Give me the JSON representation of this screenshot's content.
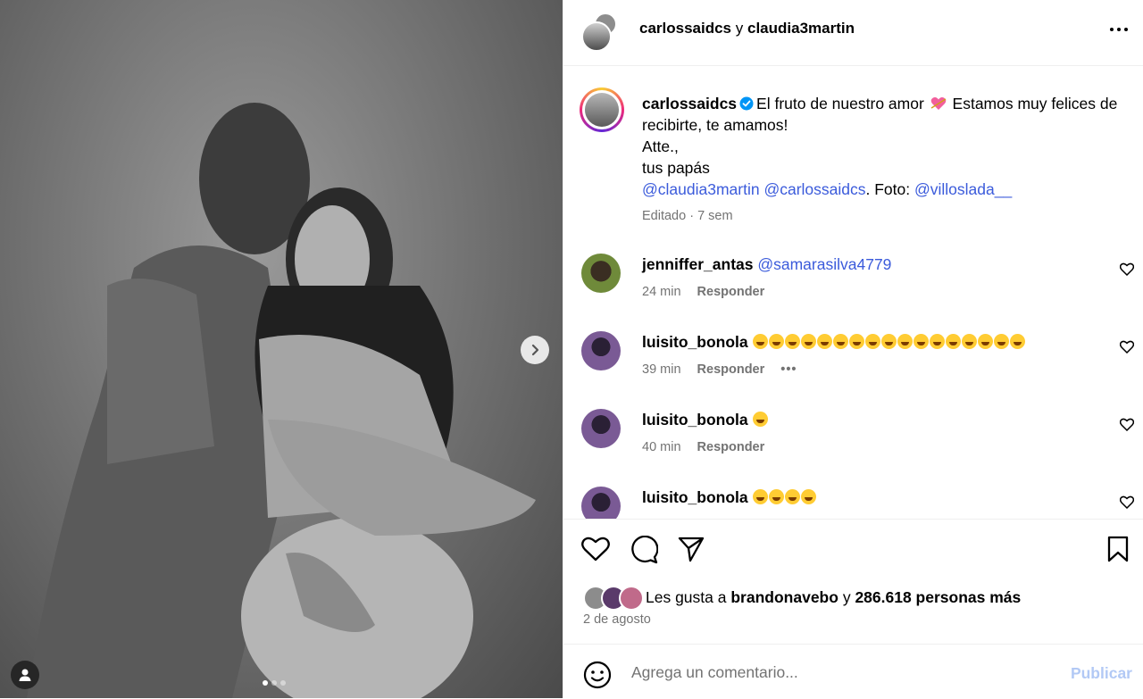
{
  "header": {
    "user1": "carlossaidcs",
    "joiner": "y",
    "user2": "claudia3martin"
  },
  "caption": {
    "username": "carlossaidcs",
    "text1": "El fruto de nuestro amor",
    "text2": "Estamos muy felices de recibirte, te amamos!",
    "line2": "Atte.,",
    "line3": "tus papás",
    "mention1": "@claudia3martin",
    "mention2": "@carlossaidcs",
    "foto_label": ". Foto:",
    "mention3": "@villoslada__",
    "edited": "Editado",
    "sep": "·",
    "time": "7 sem"
  },
  "comments": [
    {
      "username": "jenniffer_antas",
      "mention": "@samarasilva4779",
      "time": "24 min",
      "reply": "Responder"
    },
    {
      "username": "luisito_bonola",
      "emoji_count": 17,
      "time": "39 min",
      "reply": "Responder",
      "more": "•••"
    },
    {
      "username": "luisito_bonola",
      "emoji_count": 1,
      "time": "40 min",
      "reply": "Responder"
    },
    {
      "username": "luisito_bonola",
      "emoji_count": 4
    }
  ],
  "likes": {
    "prefix": "Les gusta a",
    "user": "brandonavebo",
    "joiner": "y",
    "count": "286.618 personas más"
  },
  "date": "2 de agosto",
  "comment_input": {
    "placeholder": "Agrega un comentario...",
    "publish": "Publicar"
  },
  "carousel": {
    "slides": 3,
    "current": 1
  },
  "colors": {
    "mention": "#3b5bdb",
    "verified": "#0095f6",
    "publish": "#b2c9f5"
  }
}
